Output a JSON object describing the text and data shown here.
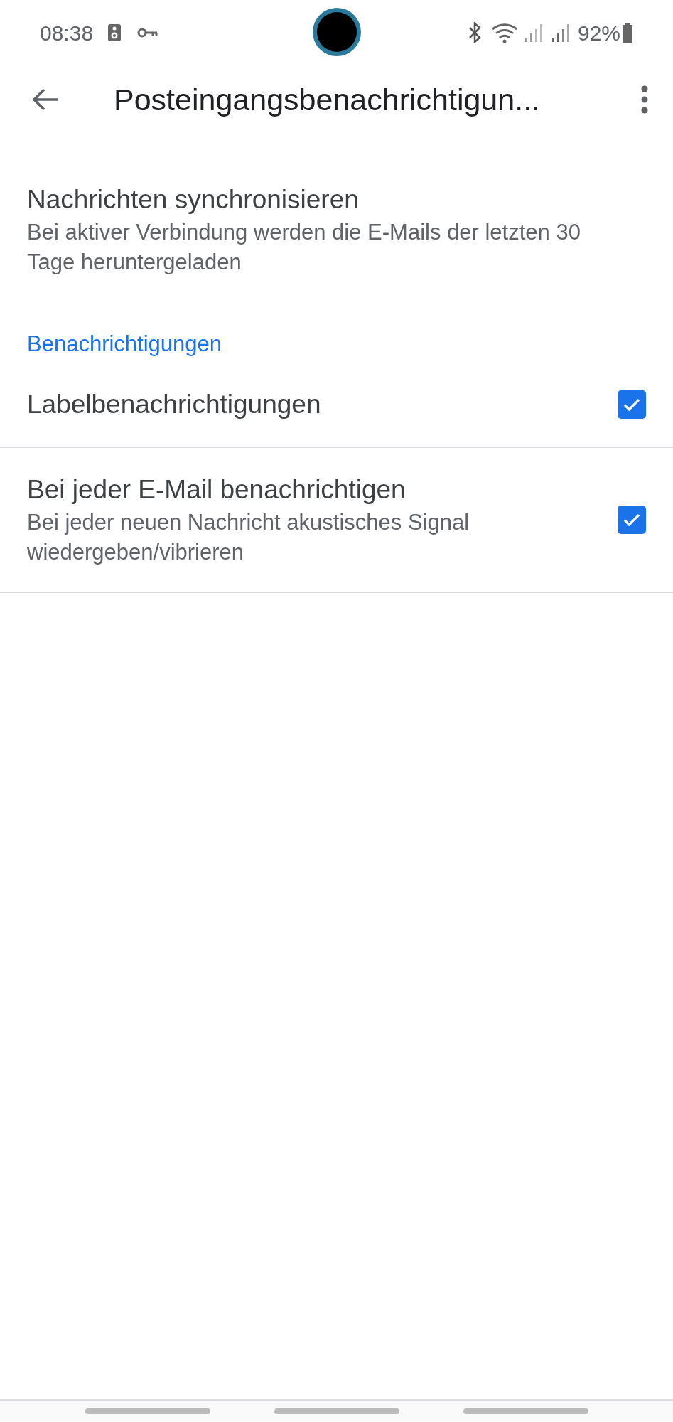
{
  "status_bar": {
    "time": "08:38",
    "battery": "92%"
  },
  "app_bar": {
    "title": "Posteingangsbenachrichtigun..."
  },
  "settings": [
    {
      "kind": "text",
      "title": "Nachrichten synchronisieren",
      "subtitle": "Bei aktiver Verbindung werden die E-Mails der letzten 30 Tage heruntergeladen"
    },
    {
      "kind": "header",
      "title": "Benachrichtigungen"
    },
    {
      "kind": "checkbox",
      "title": "Labelbenachrichtigungen",
      "checked": true
    },
    {
      "kind": "checkbox",
      "title": "Bei jeder E-Mail benachrichtigen",
      "subtitle": "Bei jeder neuen Nachricht akustisches Signal wiedergeben/vibrieren",
      "checked": true
    }
  ]
}
